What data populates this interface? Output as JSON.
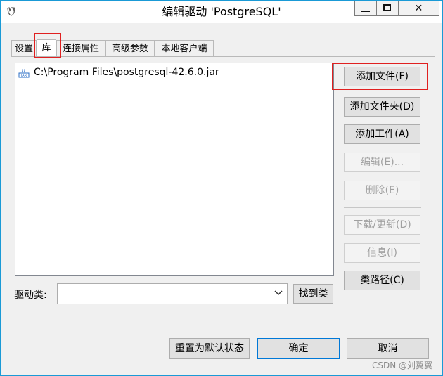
{
  "window": {
    "title": "编辑驱动 'PostgreSQL'",
    "app_icon": "database-icon",
    "close_glyph": "✕"
  },
  "tabs": [
    {
      "label": "设置",
      "active": false
    },
    {
      "label": "库",
      "active": true
    },
    {
      "label": "连接属性",
      "active": false
    },
    {
      "label": "高级参数",
      "active": false
    },
    {
      "label": "本地客户端",
      "active": false
    }
  ],
  "library": {
    "items": [
      {
        "icon": "jar-file-icon",
        "path": "C:\\Program Files\\postgresql-42.6.0.jar"
      }
    ]
  },
  "side_buttons": {
    "add_file": "添加文件(F)",
    "add_folder": "添加文件夹(D)",
    "add_artifact": "添加工件(A)",
    "edit": "编辑(E)...",
    "delete": "删除(E)",
    "download_update": "下载/更新(D)",
    "info": "信息(I)",
    "classpath": "类路径(C)"
  },
  "driver_class": {
    "label": "驱动类:",
    "value": "",
    "find_button": "找到类"
  },
  "footer": {
    "reset": "重置为默认状态",
    "ok": "确定",
    "cancel": "取消"
  },
  "watermark": "CSDN @刘翼翼",
  "colors": {
    "highlight_box": "#e02020",
    "accent": "#0078d7"
  }
}
